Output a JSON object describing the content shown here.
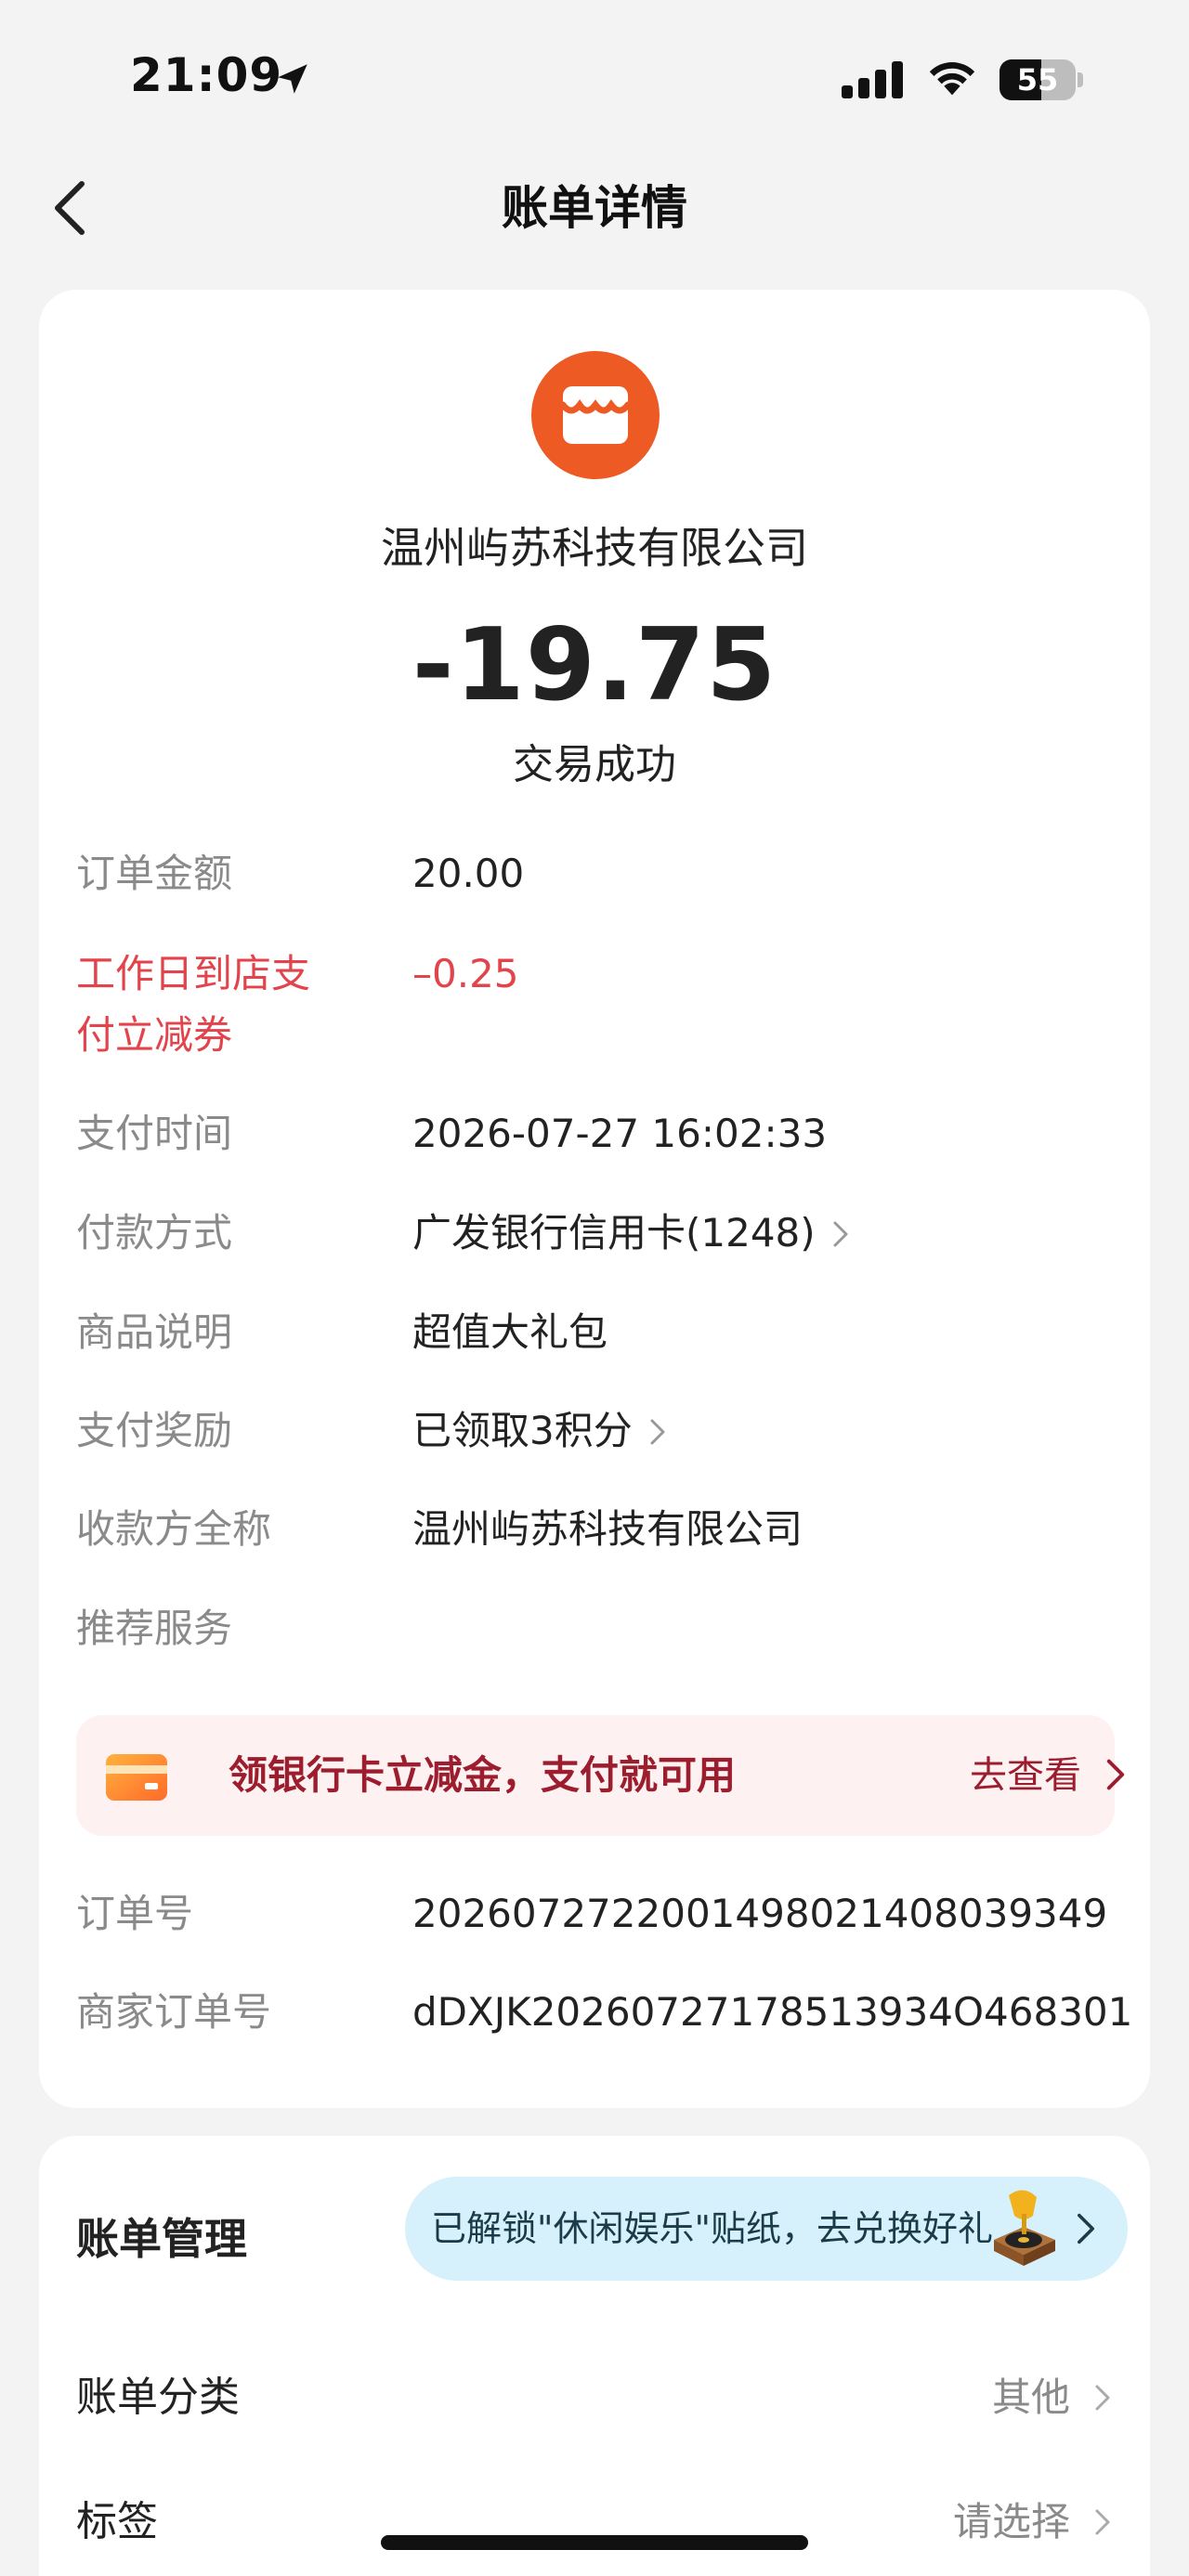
{
  "status_bar": {
    "time": "21:09",
    "battery_level": "55"
  },
  "nav": {
    "title": "账单详情",
    "back_icon": "chevron-left-icon"
  },
  "summary": {
    "merchant_logo_icon": "store-icon",
    "merchant_name": "温州屿苏科技有限公司",
    "amount": "-19.75",
    "status": "交易成功"
  },
  "details": {
    "order_amount": {
      "label": "订单金额",
      "value": "20.00"
    },
    "discount": {
      "label": "工作日到店支付立减券",
      "value": "–0.25"
    },
    "pay_time": {
      "label": "支付时间",
      "value": "2026-07-27 16:02:33"
    },
    "payment_method": {
      "label": "付款方式",
      "value": "广发银行信用卡(1248)"
    },
    "product_desc": {
      "label": "商品说明",
      "value": "超值大礼包"
    },
    "reward": {
      "label": "支付奖励",
      "value": "已领取3积分"
    },
    "payee": {
      "label": "收款方全称",
      "value": "温州屿苏科技有限公司"
    },
    "recommend": {
      "label": "推荐服务"
    },
    "order_no": {
      "label": "订单号",
      "value": "2026072722001498021408039349"
    },
    "merchant_order_no": {
      "label": "商家订单号",
      "value": "dDXJK20260727178513934O468301"
    }
  },
  "promo": {
    "icon": "bank-card-icon",
    "text": "领银行卡立减金，支付就可用",
    "link": "去查看"
  },
  "manage": {
    "title": "账单管理",
    "sticker_text": "已解锁\"休闲娱乐\"贴纸，去兑换好礼",
    "category": {
      "label": "账单分类",
      "value": "其他"
    },
    "tags": {
      "label": "标签",
      "value": "请选择"
    }
  },
  "colors": {
    "accent_red": "#e3434b",
    "logo_orange": "#ed5a24",
    "promo_bg": "#fdf1f2",
    "sticker_bg": "#d6f1fb"
  }
}
